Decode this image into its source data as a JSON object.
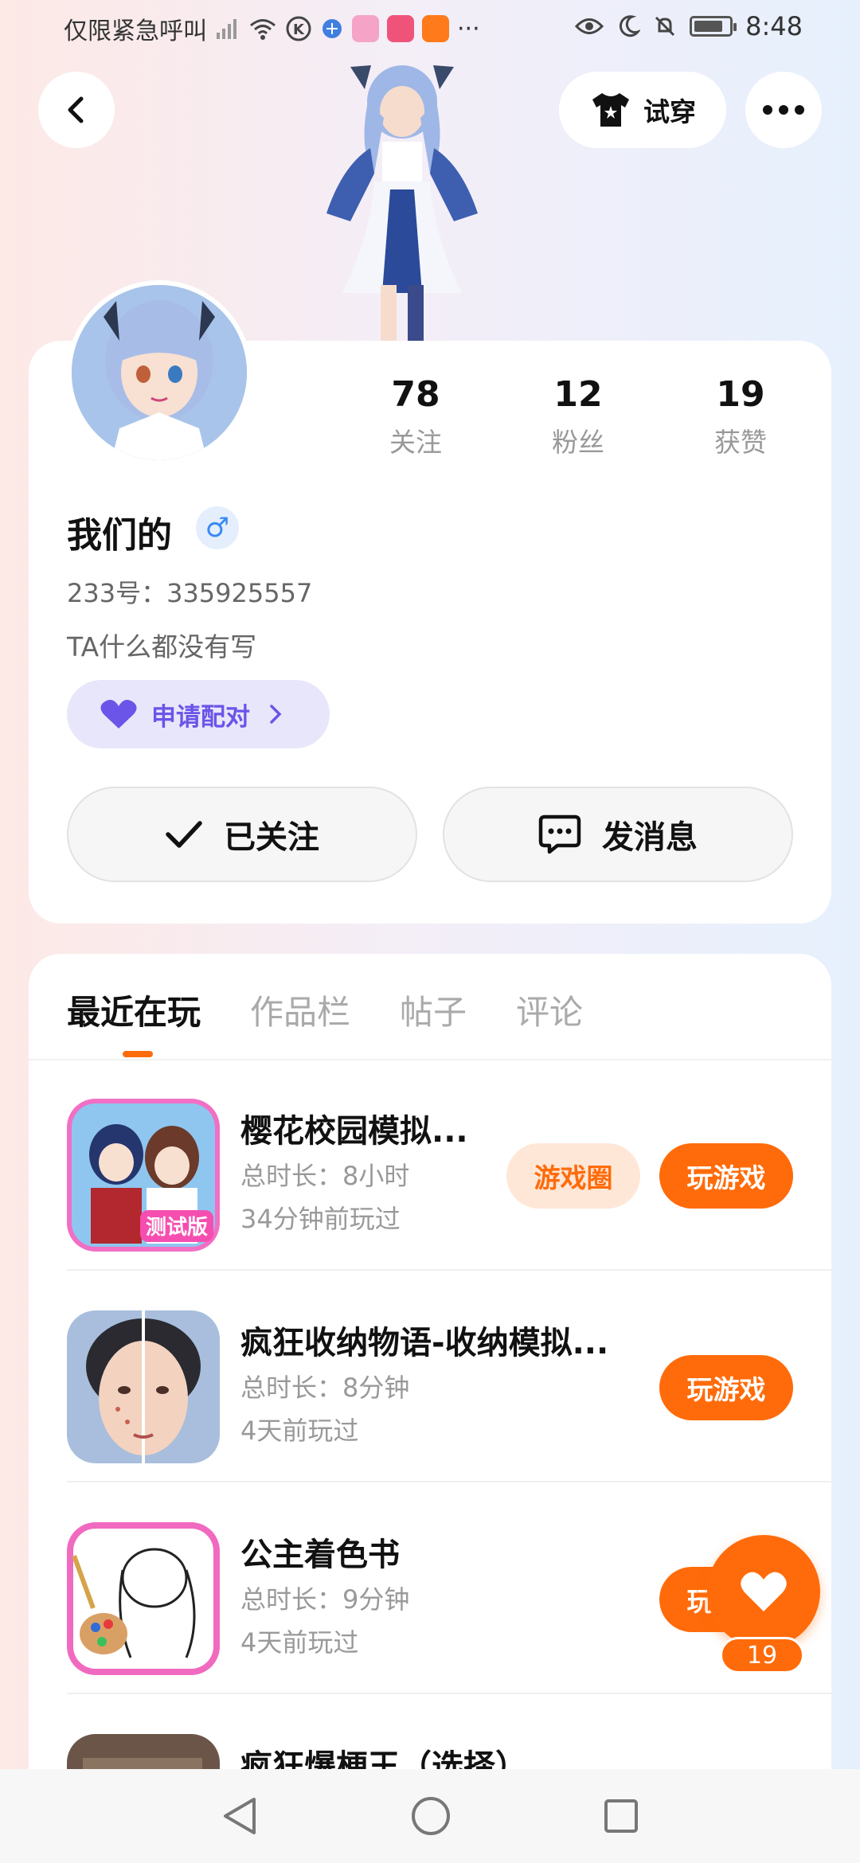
{
  "status_bar": {
    "carrier": "仅限紧急呼叫",
    "more": "···",
    "time": "8:48",
    "battery_level": 0.8
  },
  "top": {
    "tryon_label": "试穿"
  },
  "profile": {
    "stats": [
      {
        "value": "78",
        "label": "关注"
      },
      {
        "value": "12",
        "label": "粉丝"
      },
      {
        "value": "19",
        "label": "获赞"
      }
    ],
    "username": "我们的",
    "gender_symbol": "♂",
    "uid": "233号：335925557",
    "bio": "TA什么都没有写",
    "pair_label": "申请配对",
    "follow_label": "已关注",
    "message_label": "发消息"
  },
  "tabs": [
    {
      "label": "最近在玩",
      "active": true
    },
    {
      "label": "作品栏",
      "active": false
    },
    {
      "label": "帖子",
      "active": false
    },
    {
      "label": "评论",
      "active": false
    }
  ],
  "games": [
    {
      "title": "樱花校园模拟...",
      "duration": "总时长：8小时",
      "last_played": "34分钟前玩过",
      "circle_label": "游戏圈",
      "play_label": "玩游戏",
      "icon_badge": "测试版"
    },
    {
      "title": "疯狂收纳物语-收纳模拟...",
      "duration": "总时长：8分钟",
      "last_played": "4天前玩过",
      "play_label": "玩游戏"
    },
    {
      "title": "公主着色书",
      "duration": "总时长：9分钟",
      "last_played": "4天前玩过",
      "play_label": "玩游戏"
    },
    {
      "title": "疯狂爆梗王（选择）"
    }
  ],
  "like": {
    "count": "19"
  },
  "colors": {
    "accent": "#ff6b0a",
    "pair_purple": "#6a55e8",
    "gender_blue": "#3a8af0"
  }
}
